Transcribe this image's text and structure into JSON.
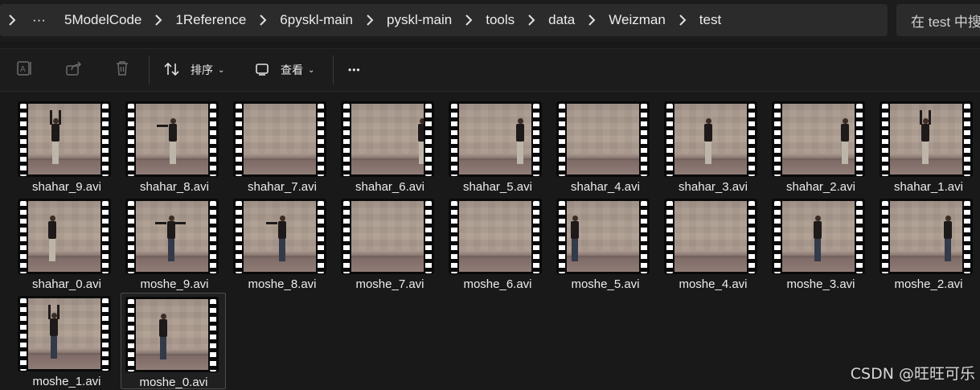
{
  "breadcrumb": {
    "items": [
      "5ModelCode",
      "1Reference",
      "6pyskl-main",
      "pyskl-main",
      "tools",
      "data",
      "Weizman",
      "test"
    ]
  },
  "search": {
    "text": "在 test 中搜"
  },
  "toolbar": {
    "sort_label": "排序",
    "view_label": "查看",
    "more_label": "•••"
  },
  "files": [
    {
      "name": "shahar_9.avi"
    },
    {
      "name": "shahar_8.avi"
    },
    {
      "name": "shahar_7.avi"
    },
    {
      "name": "shahar_6.avi"
    },
    {
      "name": "shahar_5.avi"
    },
    {
      "name": "shahar_4.avi"
    },
    {
      "name": "shahar_3.avi"
    },
    {
      "name": "shahar_2.avi"
    },
    {
      "name": "shahar_1.avi"
    },
    {
      "name": "shahar_0.avi"
    },
    {
      "name": "moshe_9.avi"
    },
    {
      "name": "moshe_8.avi"
    },
    {
      "name": "moshe_7.avi"
    },
    {
      "name": "moshe_6.avi"
    },
    {
      "name": "moshe_5.avi"
    },
    {
      "name": "moshe_4.avi"
    },
    {
      "name": "moshe_3.avi"
    },
    {
      "name": "moshe_2.avi"
    },
    {
      "name": "moshe_1.avi"
    },
    {
      "name": "moshe_0.avi"
    }
  ],
  "watermark": "CSDN @旺旺可乐"
}
